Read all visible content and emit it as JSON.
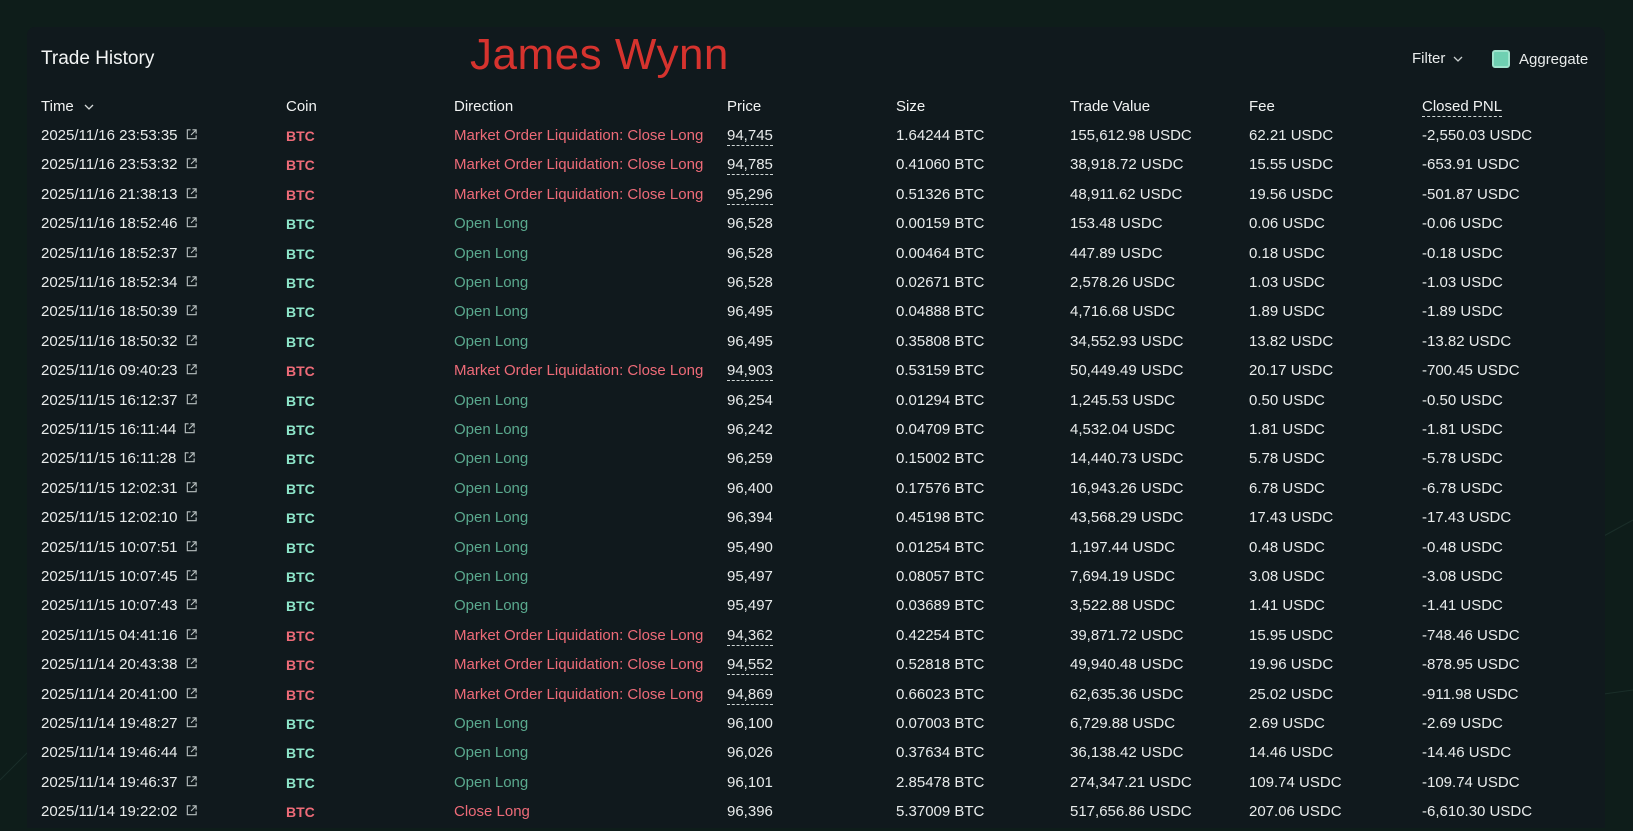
{
  "panel": {
    "title": "Trade History",
    "overlay_name": "James Wynn",
    "filter_label": "Filter",
    "aggregate_label": "Aggregate",
    "aggregate_checked": true
  },
  "columns": {
    "time": "Time",
    "coin": "Coin",
    "direction": "Direction",
    "price": "Price",
    "size": "Size",
    "trade_value": "Trade Value",
    "fee": "Fee",
    "closed_pnl": "Closed PNL"
  },
  "colors": {
    "liquidation": "#ee6b78",
    "open_long": "#5aa98e",
    "coin_long": "#8ee6ca",
    "overlay_text": "#d6332e"
  },
  "rows": [
    {
      "time": "2025/11/16 23:53:35",
      "coin": "BTC",
      "direction": "Market Order Liquidation: Close Long",
      "kind": "liq",
      "price": "94,745",
      "size": "1.64244 BTC",
      "value": "155,612.98 USDC",
      "fee": "62.21 USDC",
      "pnl": "-2,550.03 USDC"
    },
    {
      "time": "2025/11/16 23:53:32",
      "coin": "BTC",
      "direction": "Market Order Liquidation: Close Long",
      "kind": "liq",
      "price": "94,785",
      "size": "0.41060 BTC",
      "value": "38,918.72 USDC",
      "fee": "15.55 USDC",
      "pnl": "-653.91 USDC"
    },
    {
      "time": "2025/11/16 21:38:13",
      "coin": "BTC",
      "direction": "Market Order Liquidation: Close Long",
      "kind": "liq",
      "price": "95,296",
      "size": "0.51326 BTC",
      "value": "48,911.62 USDC",
      "fee": "19.56 USDC",
      "pnl": "-501.87 USDC"
    },
    {
      "time": "2025/11/16 18:52:46",
      "coin": "BTC",
      "direction": "Open Long",
      "kind": "open",
      "price": "96,528",
      "size": "0.00159 BTC",
      "value": "153.48 USDC",
      "fee": "0.06 USDC",
      "pnl": "-0.06 USDC"
    },
    {
      "time": "2025/11/16 18:52:37",
      "coin": "BTC",
      "direction": "Open Long",
      "kind": "open",
      "price": "96,528",
      "size": "0.00464 BTC",
      "value": "447.89 USDC",
      "fee": "0.18 USDC",
      "pnl": "-0.18 USDC"
    },
    {
      "time": "2025/11/16 18:52:34",
      "coin": "BTC",
      "direction": "Open Long",
      "kind": "open",
      "price": "96,528",
      "size": "0.02671 BTC",
      "value": "2,578.26 USDC",
      "fee": "1.03 USDC",
      "pnl": "-1.03 USDC"
    },
    {
      "time": "2025/11/16 18:50:39",
      "coin": "BTC",
      "direction": "Open Long",
      "kind": "open",
      "price": "96,495",
      "size": "0.04888 BTC",
      "value": "4,716.68 USDC",
      "fee": "1.89 USDC",
      "pnl": "-1.89 USDC"
    },
    {
      "time": "2025/11/16 18:50:32",
      "coin": "BTC",
      "direction": "Open Long",
      "kind": "open",
      "price": "96,495",
      "size": "0.35808 BTC",
      "value": "34,552.93 USDC",
      "fee": "13.82 USDC",
      "pnl": "-13.82 USDC"
    },
    {
      "time": "2025/11/16 09:40:23",
      "coin": "BTC",
      "direction": "Market Order Liquidation: Close Long",
      "kind": "liq",
      "price": "94,903",
      "size": "0.53159 BTC",
      "value": "50,449.49 USDC",
      "fee": "20.17 USDC",
      "pnl": "-700.45 USDC"
    },
    {
      "time": "2025/11/15 16:12:37",
      "coin": "BTC",
      "direction": "Open Long",
      "kind": "open",
      "price": "96,254",
      "size": "0.01294 BTC",
      "value": "1,245.53 USDC",
      "fee": "0.50 USDC",
      "pnl": "-0.50 USDC"
    },
    {
      "time": "2025/11/15 16:11:44",
      "coin": "BTC",
      "direction": "Open Long",
      "kind": "open",
      "price": "96,242",
      "size": "0.04709 BTC",
      "value": "4,532.04 USDC",
      "fee": "1.81 USDC",
      "pnl": "-1.81 USDC"
    },
    {
      "time": "2025/11/15 16:11:28",
      "coin": "BTC",
      "direction": "Open Long",
      "kind": "open",
      "price": "96,259",
      "size": "0.15002 BTC",
      "value": "14,440.73 USDC",
      "fee": "5.78 USDC",
      "pnl": "-5.78 USDC"
    },
    {
      "time": "2025/11/15 12:02:31",
      "coin": "BTC",
      "direction": "Open Long",
      "kind": "open",
      "price": "96,400",
      "size": "0.17576 BTC",
      "value": "16,943.26 USDC",
      "fee": "6.78 USDC",
      "pnl": "-6.78 USDC"
    },
    {
      "time": "2025/11/15 12:02:10",
      "coin": "BTC",
      "direction": "Open Long",
      "kind": "open",
      "price": "96,394",
      "size": "0.45198 BTC",
      "value": "43,568.29 USDC",
      "fee": "17.43 USDC",
      "pnl": "-17.43 USDC"
    },
    {
      "time": "2025/11/15 10:07:51",
      "coin": "BTC",
      "direction": "Open Long",
      "kind": "open",
      "price": "95,490",
      "size": "0.01254 BTC",
      "value": "1,197.44 USDC",
      "fee": "0.48 USDC",
      "pnl": "-0.48 USDC"
    },
    {
      "time": "2025/11/15 10:07:45",
      "coin": "BTC",
      "direction": "Open Long",
      "kind": "open",
      "price": "95,497",
      "size": "0.08057 BTC",
      "value": "7,694.19 USDC",
      "fee": "3.08 USDC",
      "pnl": "-3.08 USDC"
    },
    {
      "time": "2025/11/15 10:07:43",
      "coin": "BTC",
      "direction": "Open Long",
      "kind": "open",
      "price": "95,497",
      "size": "0.03689 BTC",
      "value": "3,522.88 USDC",
      "fee": "1.41 USDC",
      "pnl": "-1.41 USDC"
    },
    {
      "time": "2025/11/15 04:41:16",
      "coin": "BTC",
      "direction": "Market Order Liquidation: Close Long",
      "kind": "liq",
      "price": "94,362",
      "size": "0.42254 BTC",
      "value": "39,871.72 USDC",
      "fee": "15.95 USDC",
      "pnl": "-748.46 USDC"
    },
    {
      "time": "2025/11/14 20:43:38",
      "coin": "BTC",
      "direction": "Market Order Liquidation: Close Long",
      "kind": "liq",
      "price": "94,552",
      "size": "0.52818 BTC",
      "value": "49,940.48 USDC",
      "fee": "19.96 USDC",
      "pnl": "-878.95 USDC"
    },
    {
      "time": "2025/11/14 20:41:00",
      "coin": "BTC",
      "direction": "Market Order Liquidation: Close Long",
      "kind": "liq",
      "price": "94,869",
      "size": "0.66023 BTC",
      "value": "62,635.36 USDC",
      "fee": "25.02 USDC",
      "pnl": "-911.98 USDC"
    },
    {
      "time": "2025/11/14 19:48:27",
      "coin": "BTC",
      "direction": "Open Long",
      "kind": "open",
      "price": "96,100",
      "size": "0.07003 BTC",
      "value": "6,729.88 USDC",
      "fee": "2.69 USDC",
      "pnl": "-2.69 USDC"
    },
    {
      "time": "2025/11/14 19:46:44",
      "coin": "BTC",
      "direction": "Open Long",
      "kind": "open",
      "price": "96,026",
      "size": "0.37634 BTC",
      "value": "36,138.42 USDC",
      "fee": "14.46 USDC",
      "pnl": "-14.46 USDC"
    },
    {
      "time": "2025/11/14 19:46:37",
      "coin": "BTC",
      "direction": "Open Long",
      "kind": "open",
      "price": "96,101",
      "size": "2.85478 BTC",
      "value": "274,347.21 USDC",
      "fee": "109.74 USDC",
      "pnl": "-109.74 USDC"
    },
    {
      "time": "2025/11/14 19:22:02",
      "coin": "BTC",
      "direction": "Close Long",
      "kind": "close",
      "price": "96,396",
      "size": "5.37009 BTC",
      "value": "517,656.86 USDC",
      "fee": "207.06 USDC",
      "pnl": "-6,610.30 USDC"
    }
  ]
}
